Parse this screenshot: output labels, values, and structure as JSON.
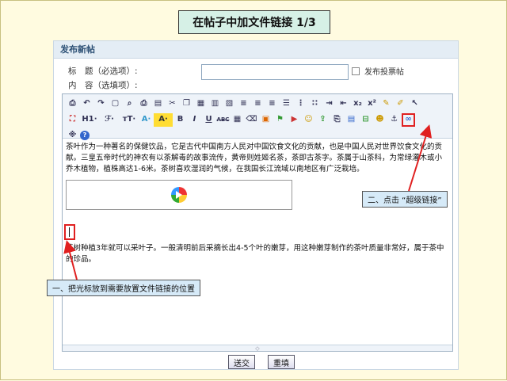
{
  "slide_title": "在帖子中加文件链接 1/3",
  "panel": {
    "header": "发布新帖",
    "title_label": "标　题（必选项）:",
    "content_label": "内　容（选填项）:",
    "poll_label": "发布投票帖"
  },
  "editor": {
    "toolbar_row1": [
      "source",
      "undo",
      "redo",
      "cut-all",
      "preview",
      "print",
      "cut",
      "copy",
      "paste",
      "paste-text",
      "paste-word",
      "align-left",
      "align-center",
      "align-right",
      "justify",
      "ordered-list",
      "unordered-list",
      "indent",
      "outdent",
      "subscript",
      "superscript",
      "clear-format",
      "select-all",
      "pointer"
    ],
    "toolbar_row2_labels": {
      "heading": "H1·",
      "font": "ℱ·",
      "size": "тT·",
      "fontcolor": "A·",
      "bgcolor": "A·",
      "bold": "B",
      "italic": "I",
      "underline": "U",
      "strike": "ABC"
    },
    "paragraph1": "茶叶作为一种著名的保健饮品，它是古代中国南方人民对中国饮食文化的贡献，也是中国人民对世界饮食文化的贡献。三皇五帝时代的神农有以茶解毒的故事流传，黄帝则姓姬名茶，茶即古茶字。茶属于山茶科，为常绿灌木或小乔木植物，植株高达1-6米。茶树喜欢湿润的气候，在我国长江流域以南地区有广泛栽培。",
    "paragraph2": "茶树种植3年就可以采叶子。一般清明前后采摘长出4-5个叶的嫩芽，用这种嫩芽制作的茶叶质量非常好，属于茶中的珍品。"
  },
  "buttons": {
    "submit": "送交",
    "reset": "重填"
  },
  "callouts": {
    "step1": "一、把光标放到需要放置文件链接的位置",
    "step2": "二、点击 “超级链接”"
  },
  "colors": {
    "annotation_red": "#e02020",
    "callout_bg": "#d6eaf8",
    "slide_bg": "#fffbe0"
  }
}
